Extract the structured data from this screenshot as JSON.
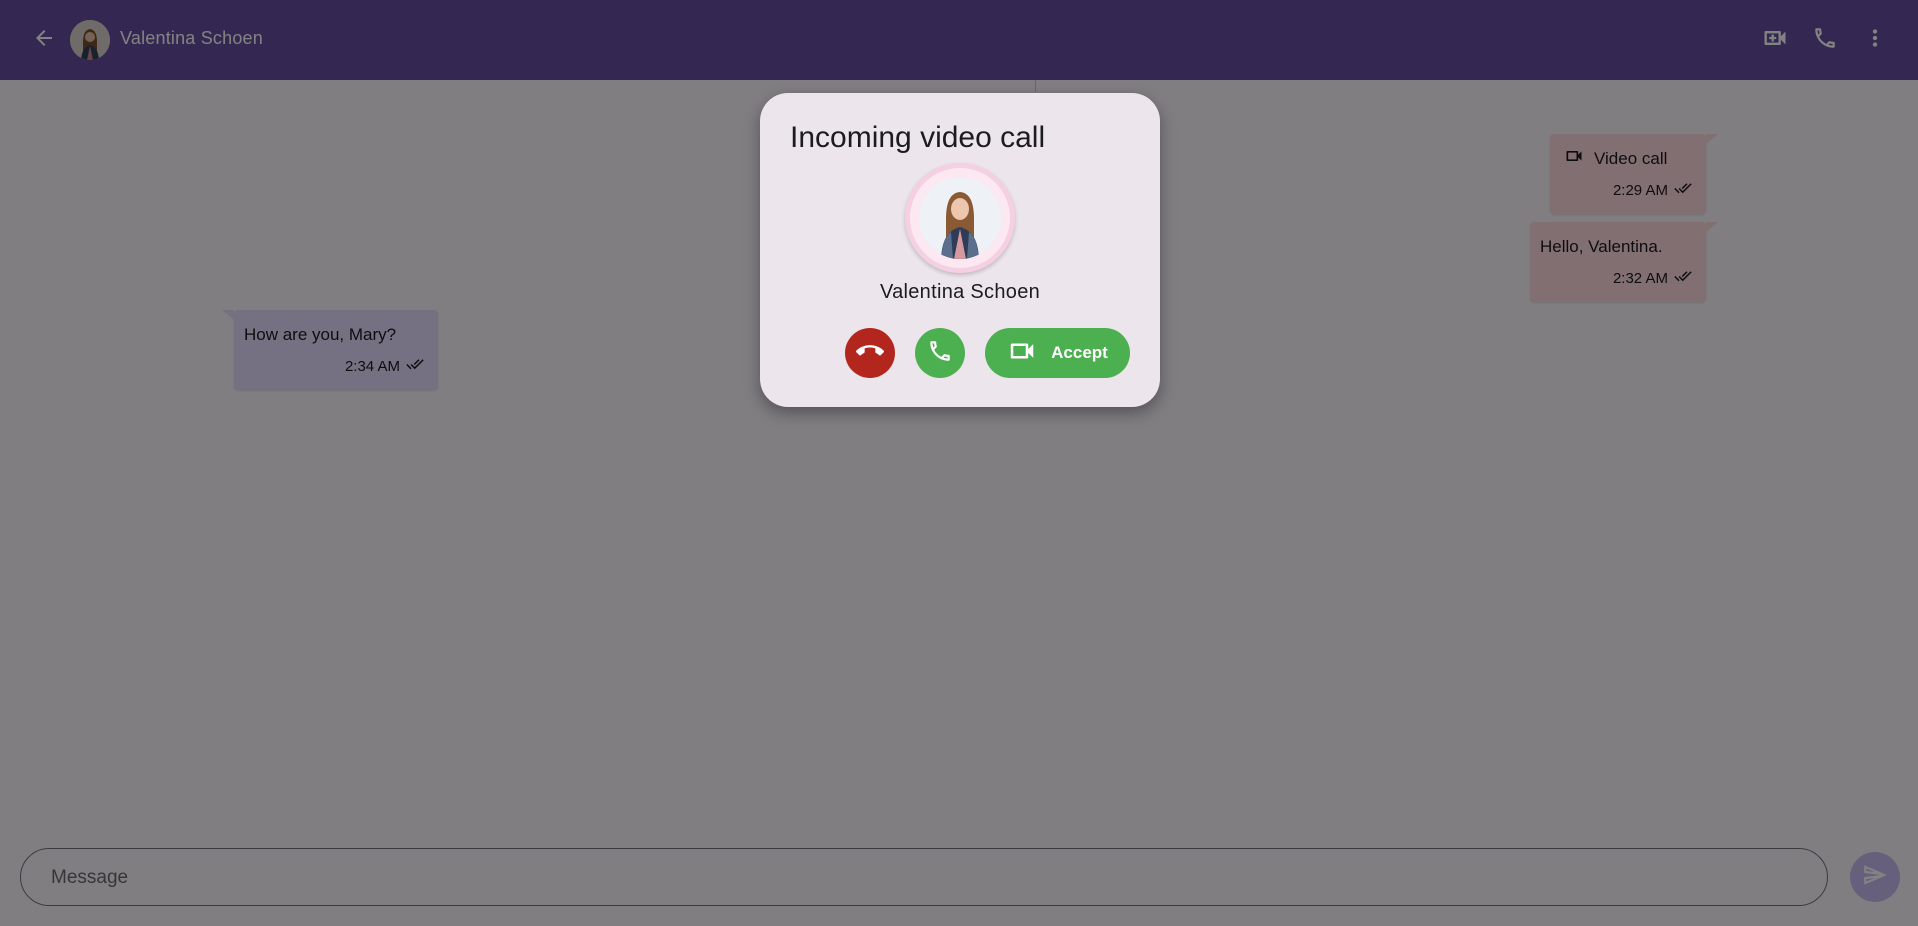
{
  "header": {
    "contact_name": "Valentina Schoen",
    "back_icon": "arrow-back-icon",
    "actions": [
      "video-call-add-icon",
      "phone-icon",
      "more-vert-icon"
    ]
  },
  "messages": [
    {
      "direction": "outgoing",
      "icon": "videocam-icon",
      "text": "Video call",
      "time": "2:29 AM",
      "status": "read"
    },
    {
      "direction": "outgoing",
      "text": "Hello, Valentina.",
      "time": "2:32 AM",
      "status": "read"
    },
    {
      "direction": "incoming",
      "text": "How are you, Mary?",
      "time": "2:34 AM",
      "status": "read"
    }
  ],
  "composer": {
    "placeholder": "Message",
    "value": ""
  },
  "dialog": {
    "title": "Incoming video call",
    "caller_name": "Valentina Schoen",
    "decline_icon": "call-end-icon",
    "voice_icon": "phone-icon",
    "accept_label": "Accept",
    "accept_icon": "videocam-icon"
  },
  "colors": {
    "primary": "#6750a4",
    "outgoing_bubble": "#ffd9de",
    "incoming_bubble": "#e5ddff",
    "decline": "#b3261e",
    "accept": "#4caf50",
    "dialog_surface": "#ece6ec"
  }
}
